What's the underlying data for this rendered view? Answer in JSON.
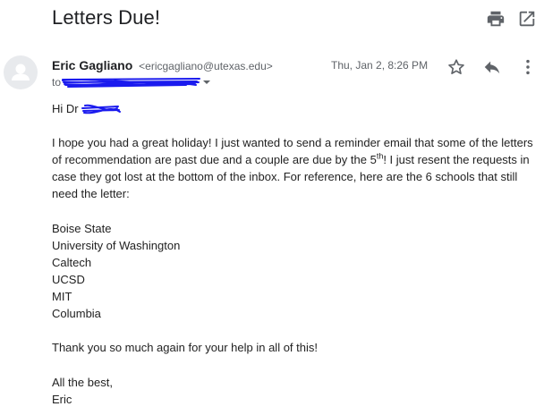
{
  "email": {
    "subject": "Letters Due!",
    "sender_name": "Eric Gagliano",
    "sender_email": "<ericgagliano@utexas.edu>",
    "date": "Thu, Jan 2, 8:26 PM",
    "to_label": "to",
    "greeting": "Hi Dr",
    "para1_line1": "I hope you had a great holiday! I just wanted to send a reminder email that some of the letters",
    "para1_line2_a": "of recommendation are past due and a couple are due by the 5",
    "para1_line2_sup": "th",
    "para1_line2_b": "! I just resent the requests in",
    "para1_line3": "case they got lost at the bottom of the inbox. For reference, here are the 6 schools that still",
    "para1_line4": "need the letter:",
    "schools": [
      "Boise State",
      "University of Washington",
      "Caltech",
      "UCSD",
      "MIT",
      "Columbia"
    ],
    "thanks": "Thank you so much again for your help in all of this!",
    "signoff": "All the best,",
    "signature": "Eric"
  },
  "icons": {
    "print": "print-icon",
    "open_new_window": "open-in-new-window-icon",
    "star": "star-icon",
    "reply": "reply-icon",
    "more": "more-vertical-icon",
    "avatar": "person-avatar-icon",
    "dropdown": "dropdown-arrow-icon"
  },
  "colors": {
    "icon_gray": "#5f6368",
    "redaction_blue": "#1a1aee",
    "avatar_bg": "#e8eaed",
    "avatar_fg": "#ffffff"
  }
}
